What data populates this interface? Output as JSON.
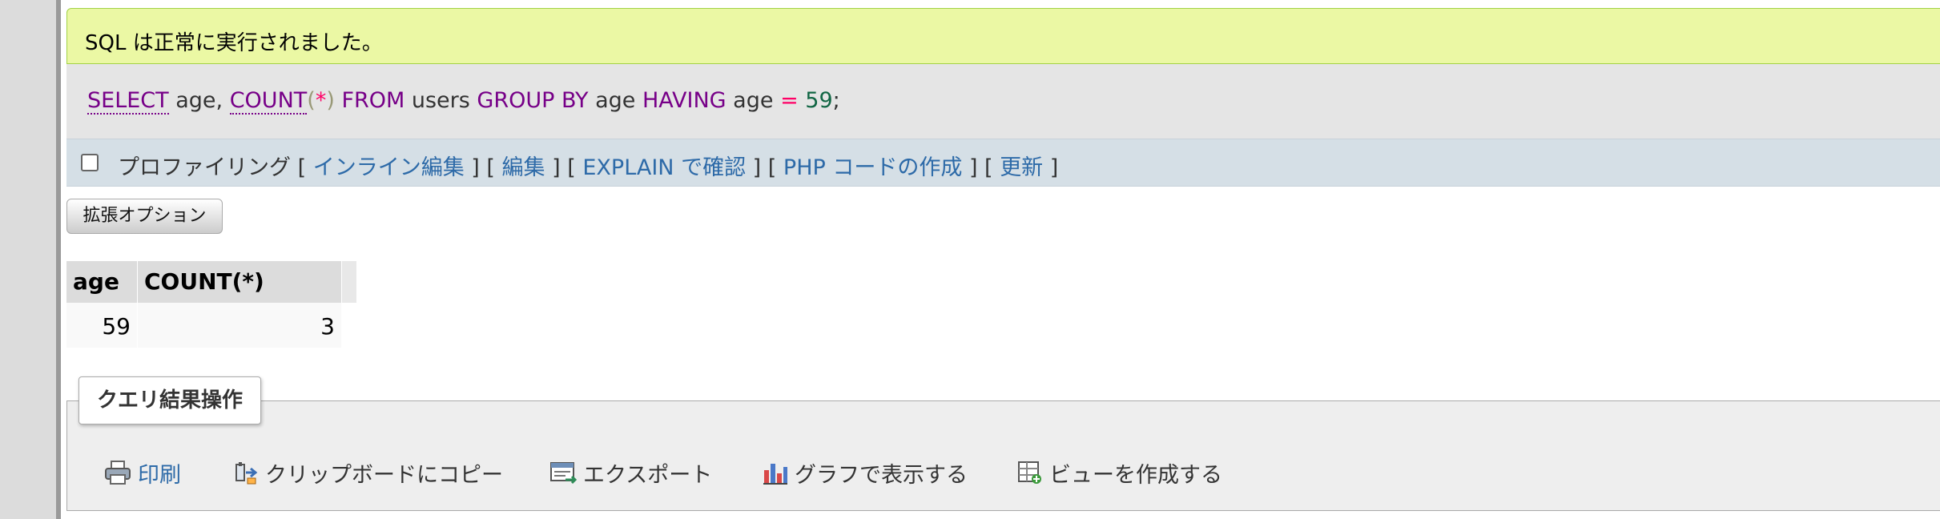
{
  "message": {
    "success_text": "SQL は正常に実行されました。"
  },
  "sql": {
    "select": "SELECT",
    "t1": " age, ",
    "count": "COUNT",
    "lparen": "(",
    "star": "*",
    "rparen": ")",
    "from": " FROM",
    "t2": " users ",
    "group_by": "GROUP BY",
    "t3": " age ",
    "having": "HAVING",
    "t4": " age ",
    "eq": "=",
    "sp": " ",
    "value": "59",
    "semi": ";"
  },
  "actions": {
    "profiling_label": "プロファイリング",
    "open": " [ ",
    "sep": " ] [ ",
    "close": " ]",
    "inline_edit": "インライン編集",
    "edit": "編集",
    "explain": "EXPLAIN で確認",
    "php_code": "PHP コードの作成",
    "refresh": "更新",
    "profiling_checked": false
  },
  "extended_options_button": "拡張オプション",
  "results": {
    "columns": [
      "age",
      "COUNT(*)"
    ],
    "rows": [
      [
        "59",
        "3"
      ]
    ]
  },
  "query_ops": {
    "legend": "クエリ結果操作",
    "items": [
      {
        "label": "印刷",
        "icon": "printer-icon"
      },
      {
        "label": "クリップボードにコピー",
        "icon": "copy-clipboard-icon"
      },
      {
        "label": "エクスポート",
        "icon": "export-icon"
      },
      {
        "label": "グラフで表示する",
        "icon": "bar-chart-icon"
      },
      {
        "label": "ビューを作成する",
        "icon": "create-view-icon"
      }
    ]
  }
}
